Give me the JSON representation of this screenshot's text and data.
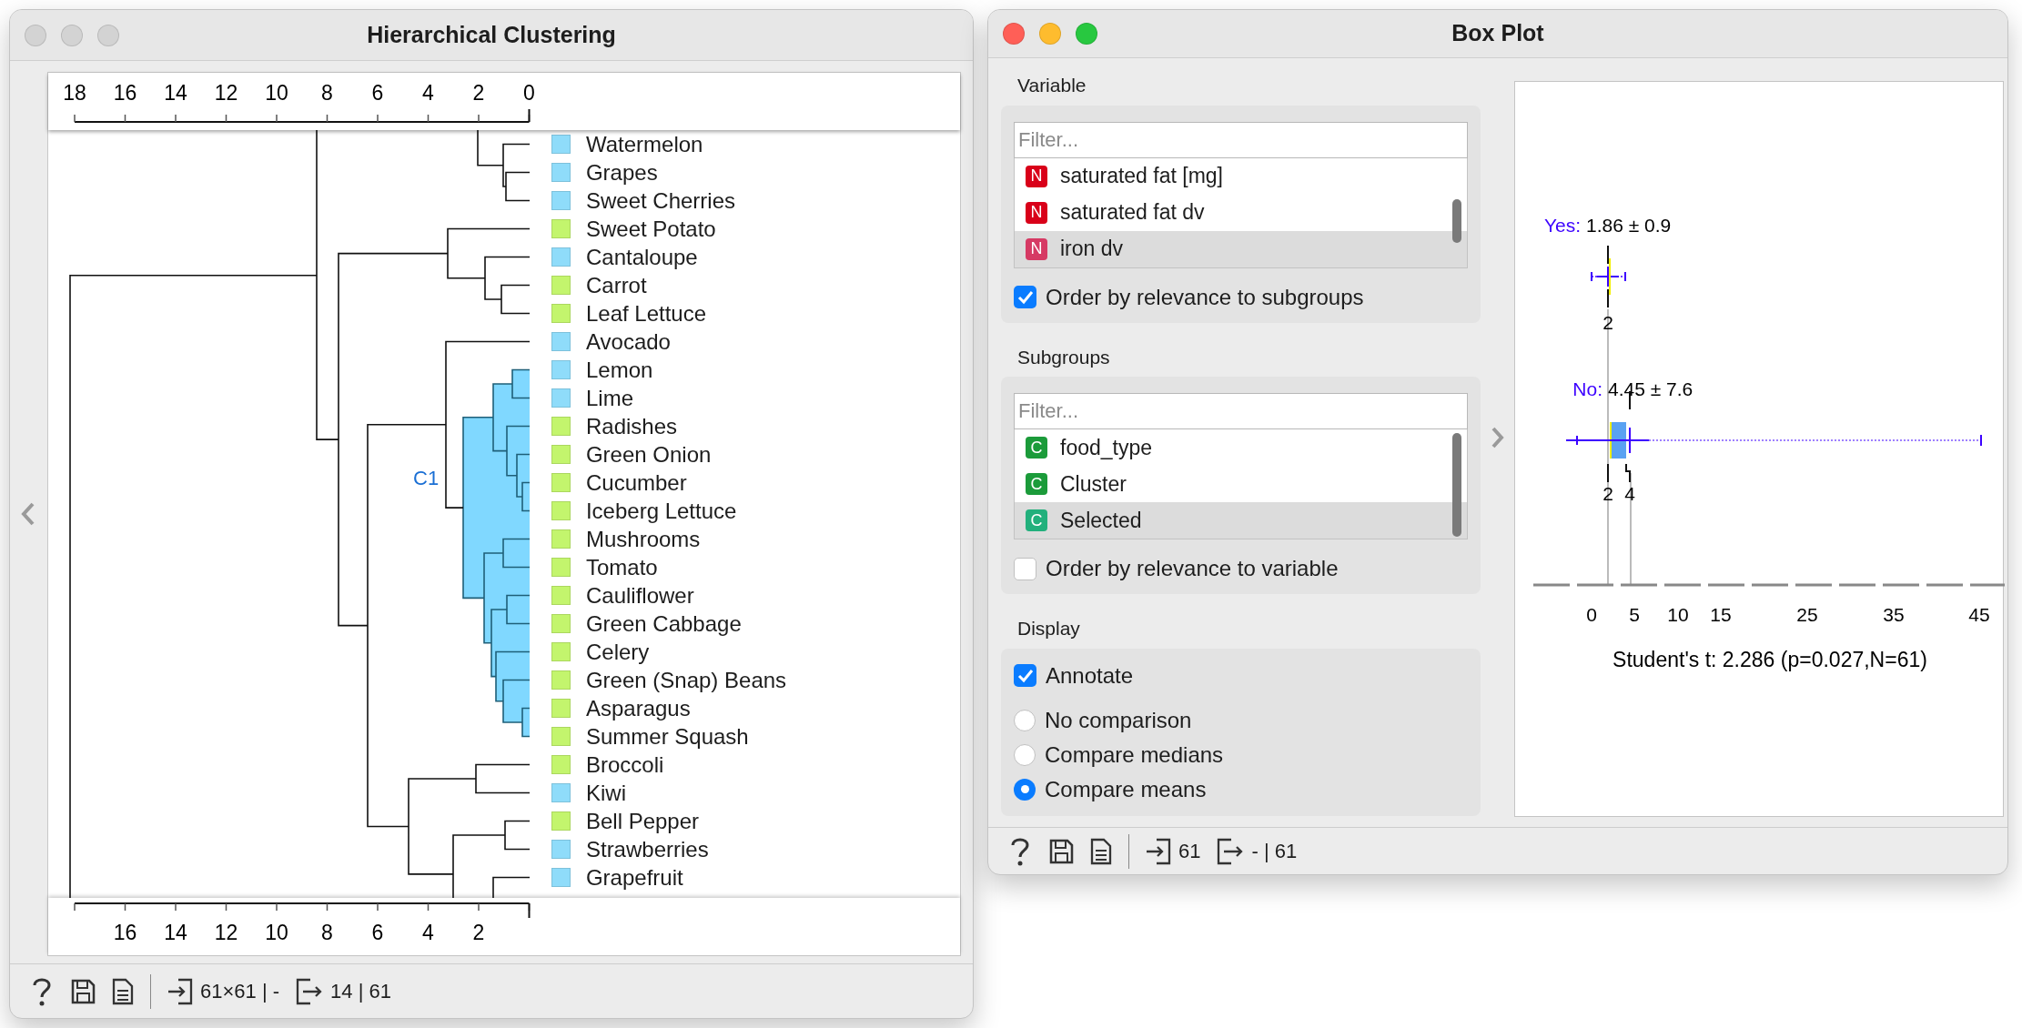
{
  "clustering_window": {
    "title": "Hierarchical Clustering",
    "active": false,
    "axis_top_ticks": [
      "18",
      "16",
      "14",
      "12",
      "10",
      "8",
      "6",
      "4",
      "2",
      "0"
    ],
    "axis_bottom_ticks": [
      "16",
      "14",
      "12",
      "10",
      "8",
      "6",
      "4",
      "2"
    ],
    "cluster_label": "C1",
    "leaves": [
      {
        "label": "Watermelon",
        "color": "#8fdcfa"
      },
      {
        "label": "Grapes",
        "color": "#8fdcfa"
      },
      {
        "label": "Sweet Cherries",
        "color": "#8fdcfa"
      },
      {
        "label": "Sweet Potato",
        "color": "#c3f56d"
      },
      {
        "label": "Cantaloupe",
        "color": "#8fdcfa"
      },
      {
        "label": "Carrot",
        "color": "#c3f56d"
      },
      {
        "label": "Leaf Lettuce",
        "color": "#c3f56d"
      },
      {
        "label": "Avocado",
        "color": "#8fdcfa"
      },
      {
        "label": "Lemon",
        "color": "#8fdcfa"
      },
      {
        "label": "Lime",
        "color": "#8fdcfa"
      },
      {
        "label": "Radishes",
        "color": "#c3f56d"
      },
      {
        "label": "Green Onion",
        "color": "#c3f56d"
      },
      {
        "label": "Cucumber",
        "color": "#c3f56d"
      },
      {
        "label": "Iceberg Lettuce",
        "color": "#c3f56d"
      },
      {
        "label": "Mushrooms",
        "color": "#c3f56d"
      },
      {
        "label": "Tomato",
        "color": "#c3f56d"
      },
      {
        "label": "Cauliflower",
        "color": "#c3f56d"
      },
      {
        "label": "Green Cabbage",
        "color": "#c3f56d"
      },
      {
        "label": "Celery",
        "color": "#c3f56d"
      },
      {
        "label": "Green (Snap) Beans",
        "color": "#c3f56d"
      },
      {
        "label": "Asparagus",
        "color": "#c3f56d"
      },
      {
        "label": "Summer Squash",
        "color": "#c3f56d"
      },
      {
        "label": "Broccoli",
        "color": "#c3f56d"
      },
      {
        "label": "Kiwi",
        "color": "#8fdcfa"
      },
      {
        "label": "Bell Pepper",
        "color": "#c3f56d"
      },
      {
        "label": "Strawberries",
        "color": "#8fdcfa"
      },
      {
        "label": "Grapefruit",
        "color": "#8fdcfa"
      }
    ],
    "footer": {
      "input": "61×61 | -",
      "output": "14 | 61"
    }
  },
  "boxplot_window": {
    "title": "Box Plot",
    "active": true,
    "variable": {
      "heading": "Variable",
      "filter_placeholder": "Filter...",
      "items": [
        {
          "badge": "N",
          "label": "saturated fat [mg]",
          "selected": false
        },
        {
          "badge": "N",
          "label": "saturated fat dv",
          "selected": false
        },
        {
          "badge": "N",
          "label": "iron dv",
          "selected": true
        }
      ],
      "order_checkbox": {
        "label": "Order by relevance to subgroups",
        "checked": true
      }
    },
    "subgroups": {
      "heading": "Subgroups",
      "filter_placeholder": "Filter...",
      "items": [
        {
          "badge": "C",
          "label": "food_type",
          "selected": false
        },
        {
          "badge": "C",
          "label": "Cluster",
          "selected": false
        },
        {
          "badge": "C",
          "label": "Selected",
          "selected": true
        }
      ],
      "order_checkbox": {
        "label": "Order by relevance to variable",
        "checked": false
      }
    },
    "display": {
      "heading": "Display",
      "annotate": {
        "label": "Annotate",
        "checked": true
      },
      "radios": [
        {
          "label": "No comparison",
          "selected": false
        },
        {
          "label": "Compare medians",
          "selected": false
        },
        {
          "label": "Compare means",
          "selected": true
        }
      ]
    },
    "plot": {
      "groups": [
        {
          "name": "Yes:",
          "stats": "1.86 ± 0.9",
          "value_labels": [
            "2"
          ]
        },
        {
          "name": "No:",
          "stats": "4.45 ± 7.6",
          "value_labels": [
            "2",
            "4"
          ]
        }
      ],
      "axis_ticks": [
        "0",
        "5",
        "10",
        "15",
        "25",
        "35",
        "45"
      ],
      "test_result": "Student's t: 2.286 (p=0.027,N=61)"
    },
    "footer": {
      "input": "61",
      "output": "- | 61"
    }
  }
}
